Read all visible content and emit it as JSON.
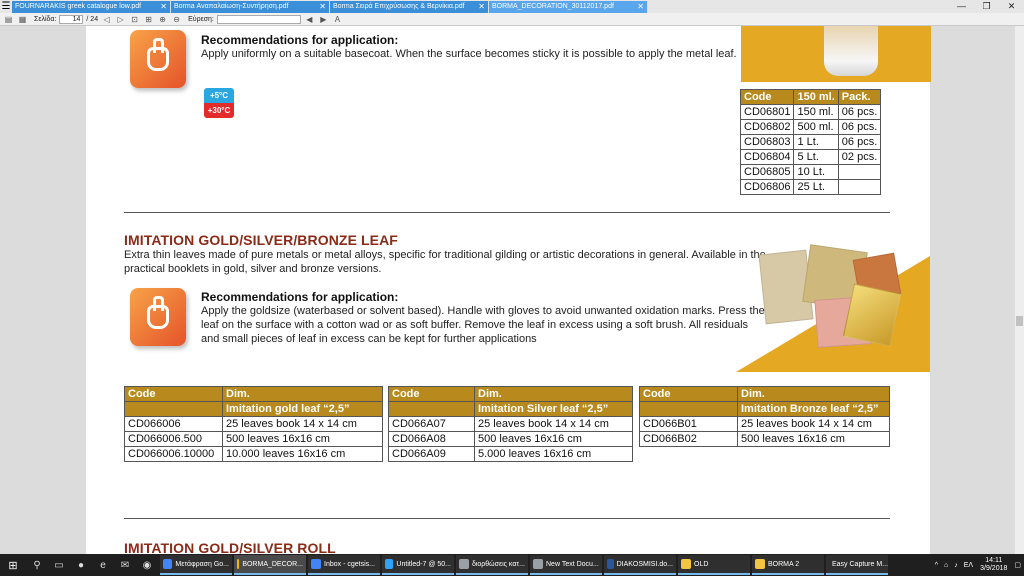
{
  "tabs": [
    {
      "label": "FOURNARAKIS greek catalogue low.pdf"
    },
    {
      "label": "Borma Αναπαλαίωση-Συντήρηση.pdf"
    },
    {
      "label": "Borma Σειρά Επιχρύσωσης & Βερνίκια.pdf"
    },
    {
      "label": "BORMA_DECORATION_30112017.pdf"
    }
  ],
  "toolbar": {
    "page_label": "Σελίδα:",
    "page_value": "14",
    "page_total": "/ 24",
    "find_label": "Εύρεση:"
  },
  "section1": {
    "rec_title": "Recommendations for application:",
    "rec_text": "Apply uniformly on a suitable basecoat. When the surface becomes sticky it is possible to apply the metal leaf.",
    "temp_min": "+5°C",
    "temp_max": "+30°C",
    "table": {
      "headers": [
        "Code",
        "150 ml.",
        "Pack."
      ],
      "rows": [
        [
          "CD06801",
          "150 ml.",
          "06 pcs."
        ],
        [
          "CD06802",
          "500 ml.",
          "06 pcs."
        ],
        [
          "CD06803",
          "1 Lt.",
          "06 pcs."
        ],
        [
          "CD06804",
          "5 Lt.",
          "02 pcs."
        ],
        [
          "CD06805",
          "10 Lt.",
          ""
        ],
        [
          "CD06806",
          "25 Lt.",
          ""
        ]
      ]
    }
  },
  "section2": {
    "title": "IMITATION GOLD/SILVER/BRONZE LEAF",
    "desc1": "Extra thin leaves made of pure metals or metal alloys, specific for traditional gilding or artistic decorations in general. Available in the",
    "desc2": "practical booklets in gold, silver and bronze versions.",
    "rec_title": "Recommendations for application:",
    "rec1": "Apply the goldsize (waterbased or solvent based). Handle with gloves to avoid unwanted oxidation marks. Press the",
    "rec2": "leaf on the surface with a cotton wad or as soft buffer. Remove the leaf in excess using a soft brush. All residuals",
    "rec3": "and small pieces of leaf in excess can be kept for further applications",
    "tables": [
      {
        "h1": "Code",
        "h2": "Dim.",
        "sub": "Imitation gold leaf “2,5”",
        "rows": [
          [
            "CD066006",
            "25 leaves book 14 x 14 cm"
          ],
          [
            "CD066006.500",
            "500 leaves 16x16 cm"
          ],
          [
            "CD066006.10000",
            "10.000 leaves 16x16 cm"
          ]
        ]
      },
      {
        "h1": "Code",
        "h2": "Dim.",
        "sub": "Imitation Silver leaf “2,5”",
        "rows": [
          [
            "CD066A07",
            "25 leaves book 14 x 14 cm"
          ],
          [
            "CD066A08",
            "500 leaves 16x16 cm"
          ],
          [
            "CD066A09",
            "5.000 leaves 16x16 cm"
          ]
        ]
      },
      {
        "h1": "Code",
        "h2": "Dim.",
        "sub": "Imitation Bronze leaf “2,5”",
        "rows": [
          [
            "CD066B01",
            "25 leaves book 14 x 14 cm"
          ],
          [
            "CD066B02",
            "500 leaves 16x16 cm"
          ]
        ]
      }
    ]
  },
  "section3": {
    "title": "IMITATION GOLD/SILVER ROLL"
  },
  "taskbar": [
    {
      "label": "Μετάφραση Go...",
      "color": "#4285f4"
    },
    {
      "label": "BORMA_DECOR...",
      "color": "#f4b400"
    },
    {
      "label": "Inbox - cgetsis...",
      "color": "#4285f4"
    },
    {
      "label": "Untitled-7 @ 50...",
      "color": "#2fa3f7"
    },
    {
      "label": "διορθώσεις κατ...",
      "color": "#9aa0a6"
    },
    {
      "label": "New Text Docu...",
      "color": "#9aa0a6"
    },
    {
      "label": "DIAKOSMISI.do...",
      "color": "#2b579a"
    },
    {
      "label": "OLD",
      "color": "#f4c542"
    },
    {
      "label": "BORMA 2",
      "color": "#f4c542"
    },
    {
      "label": "Easy Capture M...",
      "color": "#9aa0a6"
    }
  ],
  "tray": {
    "lang": "EΛ",
    "time": "14:11",
    "date": "3/9/2018"
  }
}
